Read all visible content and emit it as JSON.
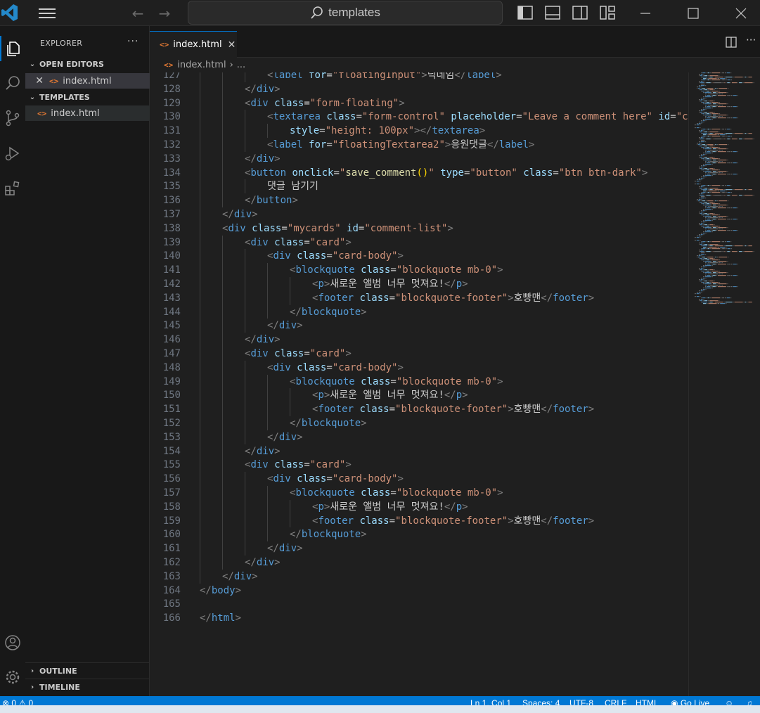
{
  "titlebar": {
    "search_text": "templates",
    "back_icon": "arrow-left-icon",
    "forward_icon": "arrow-right-icon"
  },
  "sidebar": {
    "title": "EXPLORER",
    "more": "···",
    "open_editors_label": "OPEN EDITORS",
    "open_editors": [
      {
        "name": "index.html"
      }
    ],
    "folder_label": "TEMPLATES",
    "folder_files": [
      {
        "name": "index.html"
      }
    ],
    "outline_label": "OUTLINE",
    "timeline_label": "TIMELINE"
  },
  "tabs": [
    {
      "label": "index.html",
      "active": true
    }
  ],
  "breadcrumb": {
    "file": "index.html",
    "tail": "..."
  },
  "code_lines": [
    {
      "n": "127",
      "indent": 3,
      "tokens": [
        [
          "brk",
          "<"
        ],
        [
          "tag",
          "label"
        ],
        [
          "txt",
          " "
        ],
        [
          "attr",
          "for"
        ],
        [
          "txt",
          "="
        ],
        [
          "str",
          "\"floatingInput\""
        ],
        [
          "brk",
          ">"
        ],
        [
          "txt",
          "닉네임"
        ],
        [
          "brk",
          "</"
        ],
        [
          "tag",
          "label"
        ],
        [
          "brk",
          ">"
        ]
      ]
    },
    {
      "n": "128",
      "indent": 2,
      "tokens": [
        [
          "brk",
          "</"
        ],
        [
          "tag",
          "div"
        ],
        [
          "brk",
          ">"
        ]
      ]
    },
    {
      "n": "129",
      "indent": 2,
      "tokens": [
        [
          "brk",
          "<"
        ],
        [
          "tag",
          "div"
        ],
        [
          "txt",
          " "
        ],
        [
          "attr",
          "class"
        ],
        [
          "txt",
          "="
        ],
        [
          "str",
          "\"form-floating\""
        ],
        [
          "brk",
          ">"
        ]
      ]
    },
    {
      "n": "130",
      "indent": 3,
      "tokens": [
        [
          "brk",
          "<"
        ],
        [
          "tag",
          "textarea"
        ],
        [
          "txt",
          " "
        ],
        [
          "attr",
          "class"
        ],
        [
          "txt",
          "="
        ],
        [
          "str",
          "\"form-control\""
        ],
        [
          "txt",
          " "
        ],
        [
          "attr",
          "placeholder"
        ],
        [
          "txt",
          "="
        ],
        [
          "str",
          "\"Leave a comment here\""
        ],
        [
          "txt",
          " "
        ],
        [
          "attr",
          "id"
        ],
        [
          "txt",
          "="
        ],
        [
          "str",
          "\"comme"
        ]
      ]
    },
    {
      "n": "131",
      "indent": 4,
      "tokens": [
        [
          "attr",
          "style"
        ],
        [
          "txt",
          "="
        ],
        [
          "str",
          "\"height: 100px\""
        ],
        [
          "brk",
          "></"
        ],
        [
          "tag",
          "textarea"
        ],
        [
          "brk",
          ">"
        ]
      ]
    },
    {
      "n": "132",
      "indent": 3,
      "tokens": [
        [
          "brk",
          "<"
        ],
        [
          "tag",
          "label"
        ],
        [
          "txt",
          " "
        ],
        [
          "attr",
          "for"
        ],
        [
          "txt",
          "="
        ],
        [
          "str",
          "\"floatingTextarea2\""
        ],
        [
          "brk",
          ">"
        ],
        [
          "txt",
          "응원댓글"
        ],
        [
          "brk",
          "</"
        ],
        [
          "tag",
          "label"
        ],
        [
          "brk",
          ">"
        ]
      ]
    },
    {
      "n": "133",
      "indent": 2,
      "tokens": [
        [
          "brk",
          "</"
        ],
        [
          "tag",
          "div"
        ],
        [
          "brk",
          ">"
        ]
      ]
    },
    {
      "n": "134",
      "indent": 2,
      "tokens": [
        [
          "brk",
          "<"
        ],
        [
          "tag",
          "button"
        ],
        [
          "txt",
          " "
        ],
        [
          "attr",
          "onclick"
        ],
        [
          "txt",
          "="
        ],
        [
          "str",
          "\""
        ],
        [
          "fn",
          "save_comment"
        ],
        [
          "yb",
          "()"
        ],
        [
          "str",
          "\""
        ],
        [
          "txt",
          " "
        ],
        [
          "attr",
          "type"
        ],
        [
          "txt",
          "="
        ],
        [
          "str",
          "\"button\""
        ],
        [
          "txt",
          " "
        ],
        [
          "attr",
          "class"
        ],
        [
          "txt",
          "="
        ],
        [
          "str",
          "\"btn btn-dark\""
        ],
        [
          "brk",
          ">"
        ]
      ]
    },
    {
      "n": "135",
      "indent": 3,
      "tokens": [
        [
          "txt",
          "댓글 남기기"
        ]
      ]
    },
    {
      "n": "136",
      "indent": 2,
      "tokens": [
        [
          "brk",
          "</"
        ],
        [
          "tag",
          "button"
        ],
        [
          "brk",
          ">"
        ]
      ]
    },
    {
      "n": "137",
      "indent": 1,
      "tokens": [
        [
          "brk",
          "</"
        ],
        [
          "tag",
          "div"
        ],
        [
          "brk",
          ">"
        ]
      ]
    },
    {
      "n": "138",
      "indent": 1,
      "tokens": [
        [
          "brk",
          "<"
        ],
        [
          "tag",
          "div"
        ],
        [
          "txt",
          " "
        ],
        [
          "attr",
          "class"
        ],
        [
          "txt",
          "="
        ],
        [
          "str",
          "\"mycards\""
        ],
        [
          "txt",
          " "
        ],
        [
          "attr",
          "id"
        ],
        [
          "txt",
          "="
        ],
        [
          "str",
          "\"comment-list\""
        ],
        [
          "brk",
          ">"
        ]
      ]
    },
    {
      "n": "139",
      "indent": 2,
      "tokens": [
        [
          "brk",
          "<"
        ],
        [
          "tag",
          "div"
        ],
        [
          "txt",
          " "
        ],
        [
          "attr",
          "class"
        ],
        [
          "txt",
          "="
        ],
        [
          "str",
          "\"card\""
        ],
        [
          "brk",
          ">"
        ]
      ]
    },
    {
      "n": "140",
      "indent": 3,
      "tokens": [
        [
          "brk",
          "<"
        ],
        [
          "tag",
          "div"
        ],
        [
          "txt",
          " "
        ],
        [
          "attr",
          "class"
        ],
        [
          "txt",
          "="
        ],
        [
          "str",
          "\"card-body\""
        ],
        [
          "brk",
          ">"
        ]
      ]
    },
    {
      "n": "141",
      "indent": 4,
      "tokens": [
        [
          "brk",
          "<"
        ],
        [
          "tag",
          "blockquote"
        ],
        [
          "txt",
          " "
        ],
        [
          "attr",
          "class"
        ],
        [
          "txt",
          "="
        ],
        [
          "str",
          "\"blockquote mb-0\""
        ],
        [
          "brk",
          ">"
        ]
      ]
    },
    {
      "n": "142",
      "indent": 5,
      "tokens": [
        [
          "brk",
          "<"
        ],
        [
          "tag",
          "p"
        ],
        [
          "brk",
          ">"
        ],
        [
          "txt",
          "새로운 앨범 너무 멋져요!"
        ],
        [
          "brk",
          "</"
        ],
        [
          "tag",
          "p"
        ],
        [
          "brk",
          ">"
        ]
      ]
    },
    {
      "n": "143",
      "indent": 5,
      "tokens": [
        [
          "brk",
          "<"
        ],
        [
          "tag",
          "footer"
        ],
        [
          "txt",
          " "
        ],
        [
          "attr",
          "class"
        ],
        [
          "txt",
          "="
        ],
        [
          "str",
          "\"blockquote-footer\""
        ],
        [
          "brk",
          ">"
        ],
        [
          "txt",
          "호빵맨"
        ],
        [
          "brk",
          "</"
        ],
        [
          "tag",
          "footer"
        ],
        [
          "brk",
          ">"
        ]
      ]
    },
    {
      "n": "144",
      "indent": 4,
      "tokens": [
        [
          "brk",
          "</"
        ],
        [
          "tag",
          "blockquote"
        ],
        [
          "brk",
          ">"
        ]
      ]
    },
    {
      "n": "145",
      "indent": 3,
      "tokens": [
        [
          "brk",
          "</"
        ],
        [
          "tag",
          "div"
        ],
        [
          "brk",
          ">"
        ]
      ]
    },
    {
      "n": "146",
      "indent": 2,
      "tokens": [
        [
          "brk",
          "</"
        ],
        [
          "tag",
          "div"
        ],
        [
          "brk",
          ">"
        ]
      ]
    },
    {
      "n": "147",
      "indent": 2,
      "tokens": [
        [
          "brk",
          "<"
        ],
        [
          "tag",
          "div"
        ],
        [
          "txt",
          " "
        ],
        [
          "attr",
          "class"
        ],
        [
          "txt",
          "="
        ],
        [
          "str",
          "\"card\""
        ],
        [
          "brk",
          ">"
        ]
      ]
    },
    {
      "n": "148",
      "indent": 3,
      "tokens": [
        [
          "brk",
          "<"
        ],
        [
          "tag",
          "div"
        ],
        [
          "txt",
          " "
        ],
        [
          "attr",
          "class"
        ],
        [
          "txt",
          "="
        ],
        [
          "str",
          "\"card-body\""
        ],
        [
          "brk",
          ">"
        ]
      ]
    },
    {
      "n": "149",
      "indent": 4,
      "tokens": [
        [
          "brk",
          "<"
        ],
        [
          "tag",
          "blockquote"
        ],
        [
          "txt",
          " "
        ],
        [
          "attr",
          "class"
        ],
        [
          "txt",
          "="
        ],
        [
          "str",
          "\"blockquote mb-0\""
        ],
        [
          "brk",
          ">"
        ]
      ]
    },
    {
      "n": "150",
      "indent": 5,
      "tokens": [
        [
          "brk",
          "<"
        ],
        [
          "tag",
          "p"
        ],
        [
          "brk",
          ">"
        ],
        [
          "txt",
          "새로운 앨범 너무 멋져요!"
        ],
        [
          "brk",
          "</"
        ],
        [
          "tag",
          "p"
        ],
        [
          "brk",
          ">"
        ]
      ]
    },
    {
      "n": "151",
      "indent": 5,
      "tokens": [
        [
          "brk",
          "<"
        ],
        [
          "tag",
          "footer"
        ],
        [
          "txt",
          " "
        ],
        [
          "attr",
          "class"
        ],
        [
          "txt",
          "="
        ],
        [
          "str",
          "\"blockquote-footer\""
        ],
        [
          "brk",
          ">"
        ],
        [
          "txt",
          "호빵맨"
        ],
        [
          "brk",
          "</"
        ],
        [
          "tag",
          "footer"
        ],
        [
          "brk",
          ">"
        ]
      ]
    },
    {
      "n": "152",
      "indent": 4,
      "tokens": [
        [
          "brk",
          "</"
        ],
        [
          "tag",
          "blockquote"
        ],
        [
          "brk",
          ">"
        ]
      ]
    },
    {
      "n": "153",
      "indent": 3,
      "tokens": [
        [
          "brk",
          "</"
        ],
        [
          "tag",
          "div"
        ],
        [
          "brk",
          ">"
        ]
      ]
    },
    {
      "n": "154",
      "indent": 2,
      "tokens": [
        [
          "brk",
          "</"
        ],
        [
          "tag",
          "div"
        ],
        [
          "brk",
          ">"
        ]
      ]
    },
    {
      "n": "155",
      "indent": 2,
      "tokens": [
        [
          "brk",
          "<"
        ],
        [
          "tag",
          "div"
        ],
        [
          "txt",
          " "
        ],
        [
          "attr",
          "class"
        ],
        [
          "txt",
          "="
        ],
        [
          "str",
          "\"card\""
        ],
        [
          "brk",
          ">"
        ]
      ]
    },
    {
      "n": "156",
      "indent": 3,
      "tokens": [
        [
          "brk",
          "<"
        ],
        [
          "tag",
          "div"
        ],
        [
          "txt",
          " "
        ],
        [
          "attr",
          "class"
        ],
        [
          "txt",
          "="
        ],
        [
          "str",
          "\"card-body\""
        ],
        [
          "brk",
          ">"
        ]
      ]
    },
    {
      "n": "157",
      "indent": 4,
      "tokens": [
        [
          "brk",
          "<"
        ],
        [
          "tag",
          "blockquote"
        ],
        [
          "txt",
          " "
        ],
        [
          "attr",
          "class"
        ],
        [
          "txt",
          "="
        ],
        [
          "str",
          "\"blockquote mb-0\""
        ],
        [
          "brk",
          ">"
        ]
      ]
    },
    {
      "n": "158",
      "indent": 5,
      "tokens": [
        [
          "brk",
          "<"
        ],
        [
          "tag",
          "p"
        ],
        [
          "brk",
          ">"
        ],
        [
          "txt",
          "새로운 앨범 너무 멋져요!"
        ],
        [
          "brk",
          "</"
        ],
        [
          "tag",
          "p"
        ],
        [
          "brk",
          ">"
        ]
      ]
    },
    {
      "n": "159",
      "indent": 5,
      "tokens": [
        [
          "brk",
          "<"
        ],
        [
          "tag",
          "footer"
        ],
        [
          "txt",
          " "
        ],
        [
          "attr",
          "class"
        ],
        [
          "txt",
          "="
        ],
        [
          "str",
          "\"blockquote-footer\""
        ],
        [
          "brk",
          ">"
        ],
        [
          "txt",
          "호빵맨"
        ],
        [
          "brk",
          "</"
        ],
        [
          "tag",
          "footer"
        ],
        [
          "brk",
          ">"
        ]
      ]
    },
    {
      "n": "160",
      "indent": 4,
      "tokens": [
        [
          "brk",
          "</"
        ],
        [
          "tag",
          "blockquote"
        ],
        [
          "brk",
          ">"
        ]
      ]
    },
    {
      "n": "161",
      "indent": 3,
      "tokens": [
        [
          "brk",
          "</"
        ],
        [
          "tag",
          "div"
        ],
        [
          "brk",
          ">"
        ]
      ]
    },
    {
      "n": "162",
      "indent": 2,
      "tokens": [
        [
          "brk",
          "</"
        ],
        [
          "tag",
          "div"
        ],
        [
          "brk",
          ">"
        ]
      ]
    },
    {
      "n": "163",
      "indent": 1,
      "tokens": [
        [
          "brk",
          "</"
        ],
        [
          "tag",
          "div"
        ],
        [
          "brk",
          ">"
        ]
      ]
    },
    {
      "n": "164",
      "indent": 0,
      "tokens": [
        [
          "brk",
          "</"
        ],
        [
          "tag",
          "body"
        ],
        [
          "brk",
          ">"
        ]
      ]
    },
    {
      "n": "165",
      "indent": 0,
      "tokens": []
    },
    {
      "n": "166",
      "indent": 0,
      "tokens": [
        [
          "brk",
          "</"
        ],
        [
          "tag",
          "html"
        ],
        [
          "brk",
          ">"
        ]
      ]
    }
  ],
  "statusbar": {
    "errors": "0",
    "warnings": "0",
    "position": "Ln 1, Col 1",
    "spaces": "Spaces: 4",
    "encoding": "UTF-8",
    "eol": "CRLF",
    "language": "HTML",
    "golive": "Go Live"
  },
  "colors": {
    "accent": "#0078d4",
    "tag": "#569cd6",
    "attr": "#9cdcfe",
    "string": "#ce9178",
    "function": "#dcdcaa"
  }
}
